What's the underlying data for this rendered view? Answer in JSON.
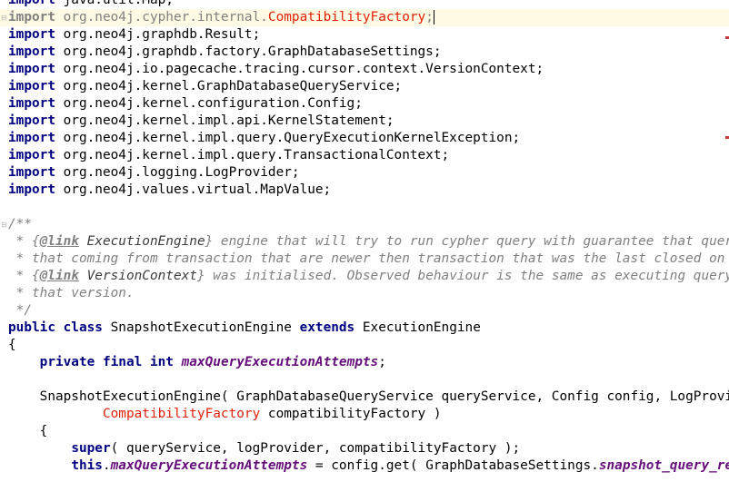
{
  "editor": {
    "current_line_index": 1,
    "lines": [
      [
        {
          "t": "import",
          "c": "kw"
        },
        {
          "t": " java.util.Map;",
          "c": "plain"
        }
      ],
      [
        {
          "t": "import",
          "c": "kw-dim"
        },
        {
          "t": " org.neo4j.cypher.internal.",
          "c": "dim"
        },
        {
          "t": "CompatibilityFactory",
          "c": "err"
        },
        {
          "t": ";",
          "c": "dim"
        }
      ],
      [
        {
          "t": "import",
          "c": "kw"
        },
        {
          "t": " org.neo4j.graphdb.Result;",
          "c": "plain"
        }
      ],
      [
        {
          "t": "import",
          "c": "kw"
        },
        {
          "t": " org.neo4j.graphdb.factory.GraphDatabaseSettings;",
          "c": "plain"
        }
      ],
      [
        {
          "t": "import",
          "c": "kw"
        },
        {
          "t": " org.neo4j.io.pagecache.tracing.cursor.context.VersionContext;",
          "c": "plain"
        }
      ],
      [
        {
          "t": "import",
          "c": "kw"
        },
        {
          "t": " org.neo4j.kernel.GraphDatabaseQueryService;",
          "c": "plain"
        }
      ],
      [
        {
          "t": "import",
          "c": "kw"
        },
        {
          "t": " org.neo4j.kernel.configuration.Config;",
          "c": "plain"
        }
      ],
      [
        {
          "t": "import",
          "c": "kw"
        },
        {
          "t": " org.neo4j.kernel.impl.api.KernelStatement;",
          "c": "plain"
        }
      ],
      [
        {
          "t": "import",
          "c": "kw"
        },
        {
          "t": " org.neo4j.kernel.impl.query.QueryExecutionKernelException;",
          "c": "plain"
        }
      ],
      [
        {
          "t": "import",
          "c": "kw"
        },
        {
          "t": " org.neo4j.kernel.impl.query.TransactionalContext;",
          "c": "plain"
        }
      ],
      [
        {
          "t": "import",
          "c": "kw"
        },
        {
          "t": " org.neo4j.logging.LogProvider;",
          "c": "plain"
        }
      ],
      [
        {
          "t": "import",
          "c": "kw"
        },
        {
          "t": " org.neo4j.values.virtual.MapValue;",
          "c": "plain"
        }
      ],
      [],
      [
        {
          "t": "/**",
          "c": "doc"
        }
      ],
      [
        {
          "t": " * {",
          "c": "doc"
        },
        {
          "t": "@link",
          "c": "doc-tag"
        },
        {
          "t": " ExecutionEngine",
          "c": "doc-link"
        },
        {
          "t": "} engine that will try to run cypher query with guarantee that query will n",
          "c": "doc"
        }
      ],
      [
        {
          "t": " * that coming from transaction that are newer then transaction that was the last closed on a moment",
          "c": "doc"
        }
      ],
      [
        {
          "t": " * {",
          "c": "doc"
        },
        {
          "t": "@link",
          "c": "doc-tag"
        },
        {
          "t": " VersionContext",
          "c": "doc-link"
        },
        {
          "t": "} was initialised. Observed behaviour is the same as executing query on top",
          "c": "doc"
        }
      ],
      [
        {
          "t": " * that version.",
          "c": "doc"
        }
      ],
      [
        {
          "t": " */",
          "c": "doc"
        }
      ],
      [
        {
          "t": "public class",
          "c": "kw"
        },
        {
          "t": " SnapshotExecutionEngine ",
          "c": "plain"
        },
        {
          "t": "extends",
          "c": "kw"
        },
        {
          "t": " ExecutionEngine",
          "c": "plain"
        }
      ],
      [
        {
          "t": "{",
          "c": "plain"
        }
      ],
      [
        {
          "t": "    ",
          "c": "plain"
        },
        {
          "t": "private final int",
          "c": "kw"
        },
        {
          "t": " ",
          "c": "plain"
        },
        {
          "t": "maxQueryExecutionAttempts",
          "c": "field"
        },
        {
          "t": ";",
          "c": "plain"
        }
      ],
      [],
      [
        {
          "t": "    SnapshotExecutionEngine( GraphDatabaseQueryService queryService, Config config, LogProvider logPr",
          "c": "plain"
        }
      ],
      [
        {
          "t": "            ",
          "c": "plain"
        },
        {
          "t": "CompatibilityFactory",
          "c": "err"
        },
        {
          "t": " compatibilityFactory )",
          "c": "plain"
        }
      ],
      [
        {
          "t": "    {",
          "c": "plain"
        }
      ],
      [
        {
          "t": "        ",
          "c": "plain"
        },
        {
          "t": "super",
          "c": "kw"
        },
        {
          "t": "( queryService, logProvider, compatibilityFactory );",
          "c": "plain"
        }
      ],
      [
        {
          "t": "        ",
          "c": "plain"
        },
        {
          "t": "this",
          "c": "kw"
        },
        {
          "t": ".",
          "c": "plain"
        },
        {
          "t": "maxQueryExecutionAttempts",
          "c": "field"
        },
        {
          "t": " = config.get( GraphDatabaseSettings.",
          "c": "plain"
        },
        {
          "t": "snapshot_query_retries",
          "c": "field"
        },
        {
          "t": " );",
          "c": "plain"
        }
      ]
    ]
  }
}
